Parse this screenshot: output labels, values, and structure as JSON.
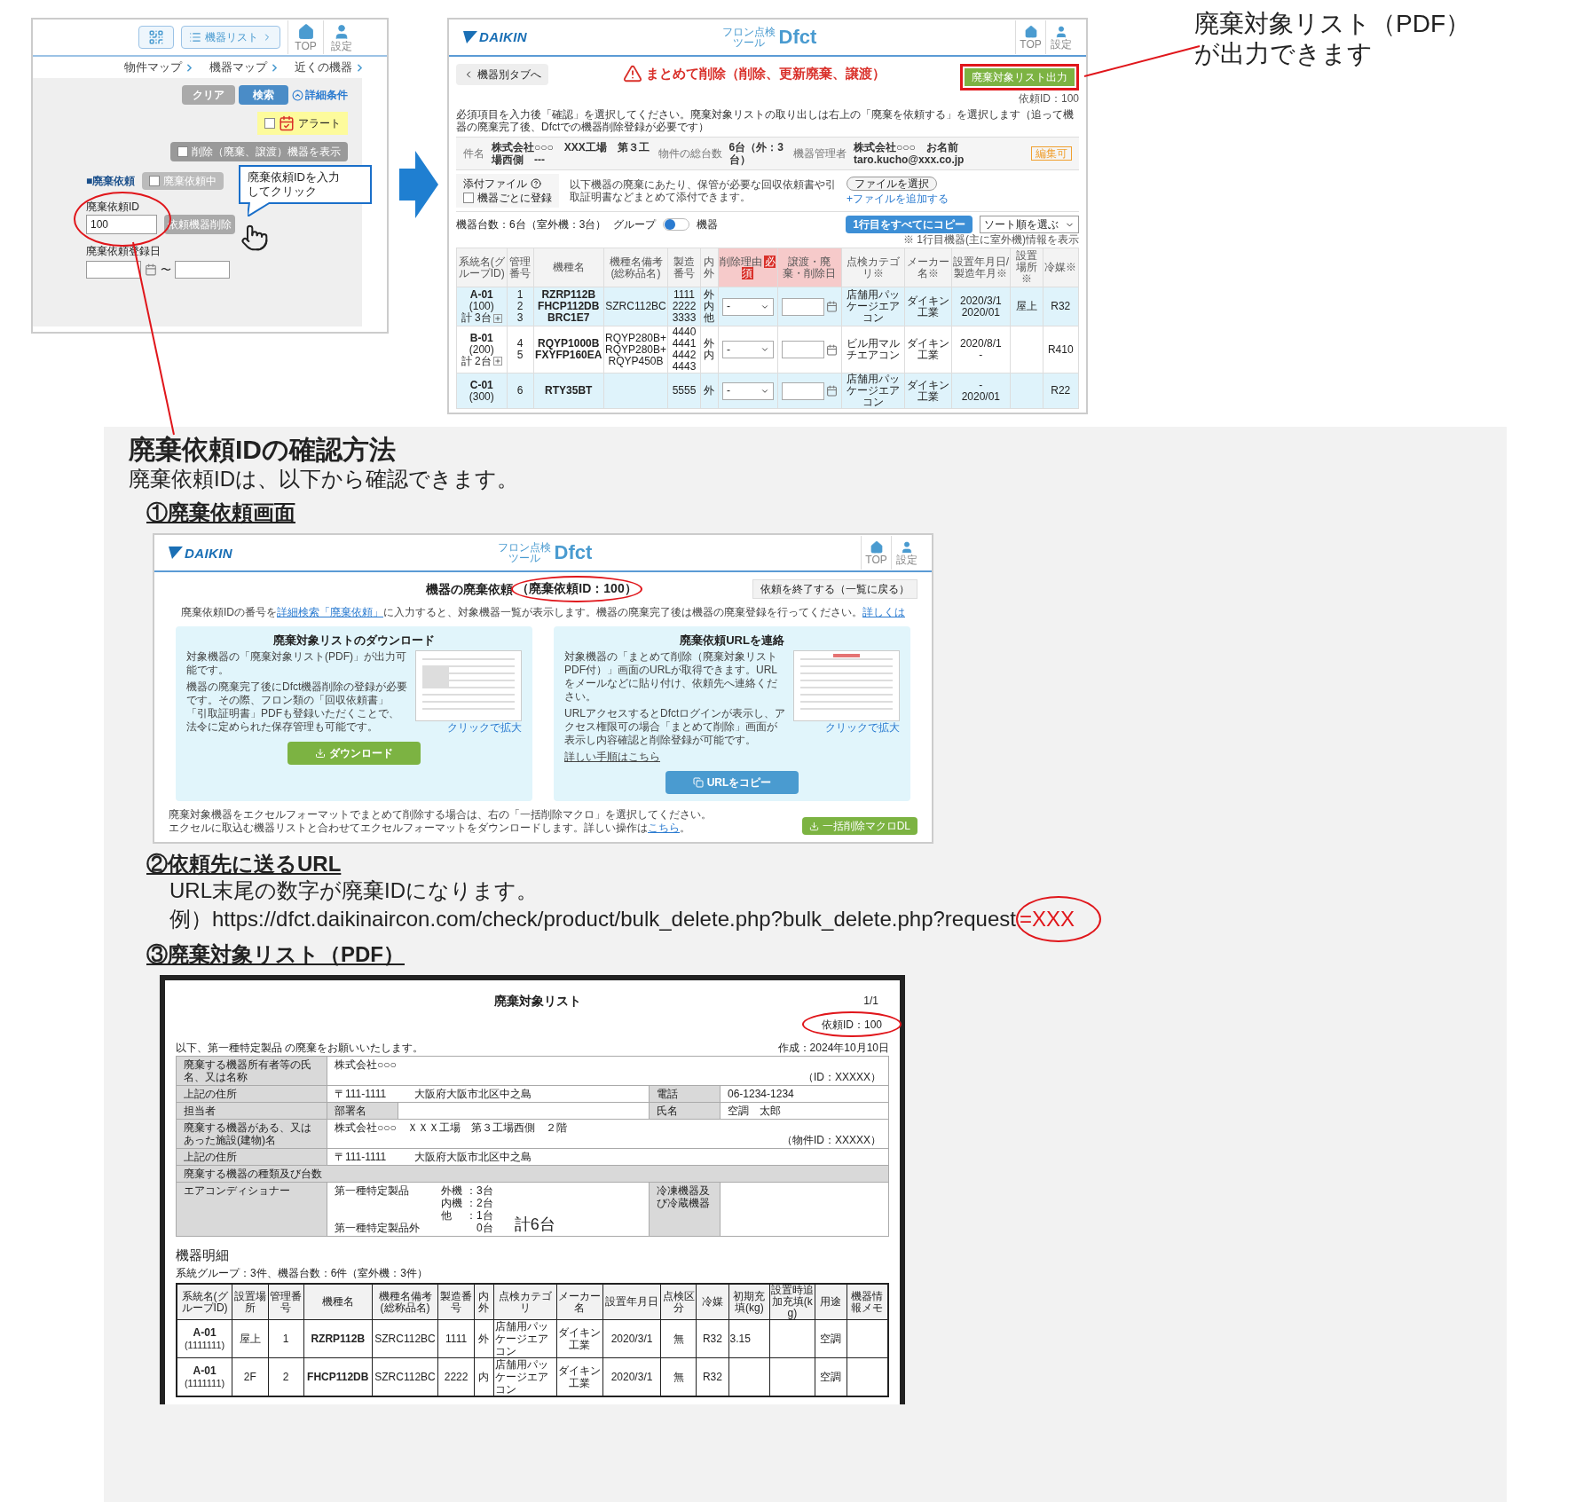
{
  "search_screen": {
    "list_button": "機器リスト",
    "header_icons": [
      {
        "kind": "home",
        "label": "TOP"
      },
      {
        "kind": "user",
        "label": "設定"
      }
    ],
    "nav_links": [
      "物件マップ",
      "機器マップ",
      "近くの機器"
    ],
    "clear_button": "クリア",
    "search_button": "検索",
    "detail_link": "詳細条件",
    "alert": {
      "label": "アラート",
      "checked": false
    },
    "show_deleted": {
      "label": "削除（廃棄、譲渡）機器を表示",
      "checked": false
    },
    "section_label": "■廃棄依頼",
    "pending": {
      "label": "廃棄依頼中",
      "checked": false
    },
    "request_id": {
      "label": "廃棄依頼ID",
      "value": "100"
    },
    "delete_button": "依頼機器削除",
    "date": {
      "label": "廃棄依頼登録日",
      "separator": "〜"
    },
    "callout": [
      "廃棄依頼IDを入力",
      "してクリック"
    ]
  },
  "bulk_delete_screen": {
    "header": {
      "logo": "DAIKIN",
      "app_subtitle": [
        "フロン点検",
        "ツール"
      ],
      "app_name": "Dfct",
      "icons": [
        {
          "kind": "home",
          "label": "TOP"
        },
        {
          "kind": "user",
          "label": "設定"
        }
      ]
    },
    "back_button": "機器別タブへ",
    "title": "まとめて削除（削除、更新廃棄、譲渡）",
    "export_button": "廃棄対象リスト出力",
    "request_id": "依頼ID：100",
    "instruction": "必須項目を入力後「確認」を選択してください。廃棄対象リストの取り出しは右上の「廃棄を依頼する」を選択します（追って機器の廃棄完了後、Dfctでの機器削除登録が必要です）",
    "info": [
      {
        "label": "件名",
        "value": "株式会社○○○　XXX工場　第３工場西側　---"
      },
      {
        "label": "物件の総台数",
        "value": "6台（外：3台）"
      },
      {
        "label": "機器管理者",
        "value": "株式会社○○○　お名前　taro.kucho@xxx.co.jp"
      }
    ],
    "edit_badge": "編集可",
    "attachment": {
      "label": "添付ファイル",
      "per_device": {
        "label": "機器ごとに登録",
        "checked": false
      },
      "note": "以下機器の廃棄にあたり、保管が必要な回収依頼書や引取証明書などまとめて添付できます。",
      "file_button": "ファイルを選択",
      "add_link": "+ファイルを追加する"
    },
    "count": "機器台数：6台（室外機：3台）",
    "view_toggle": {
      "left": "グループ",
      "right": "機器",
      "on": false
    },
    "copy_button": "1行目をすべてにコピー",
    "sort_select": "ソート順を選ぶ",
    "sort_note": "※ 1行目機器(主に室外機)情報を表示",
    "columns": [
      {
        "label": "系統名(グループID)",
        "required": false
      },
      {
        "label": "管理番号",
        "required": false
      },
      {
        "label": "機種名",
        "required": false
      },
      {
        "label": "機種名備考(総称品名)",
        "required": false
      },
      {
        "label": "製造番号",
        "required": false
      },
      {
        "label": "内外",
        "required": false
      },
      {
        "label": "削除理由",
        "required": true,
        "badge": "必須"
      },
      {
        "label": "譲渡・廃棄・削除日",
        "required": true
      },
      {
        "label": "点検カテゴリ※",
        "required": false
      },
      {
        "label": "メーカー名※",
        "required": false
      },
      {
        "label": "設置年月日/製造年月※",
        "required": false
      },
      {
        "label": "設置場所※",
        "required": false
      },
      {
        "label": "冷媒※",
        "required": false
      }
    ],
    "rows": [
      {
        "group": "A-01",
        "group_id": "(100)",
        "total": "計 3台",
        "numbers": [
          "1",
          "2",
          "3"
        ],
        "models": [
          "RZRP112B",
          "FHCP112DB",
          "BRC1E7"
        ],
        "model_notes": [
          "SZRC112BC"
        ],
        "serials": [
          "1111",
          "2222",
          "3333"
        ],
        "inout": [
          "外",
          "内",
          "他"
        ],
        "reason": "-",
        "category": "店舗用パッケージエアコン",
        "maker": "ダイキン工業",
        "dates": [
          "2020/3/1",
          "2020/01"
        ],
        "place": "屋上",
        "refrigerant": "R32"
      },
      {
        "group": "B-01",
        "group_id": "(200)",
        "total": "計 2台",
        "numbers": [
          "4",
          "5"
        ],
        "models": [
          "RQYP1000B",
          "FXYFP160EA"
        ],
        "model_notes": [
          "RQYP280B+",
          "RQYP280B+",
          "RQYP450B"
        ],
        "serials": [
          "4440",
          "4441",
          "4442",
          "4443"
        ],
        "inout": [
          "外",
          "内"
        ],
        "reason": "-",
        "category": "ビル用マルチエアコン",
        "maker": "ダイキン工業",
        "dates": [
          "2020/8/1",
          "-"
        ],
        "refrigerant": "R410"
      },
      {
        "group": "C-01",
        "group_id": "(300)",
        "numbers": [
          "6"
        ],
        "models": [
          "RTY35BT"
        ],
        "serials": [
          "5555"
        ],
        "inout": [
          "外"
        ],
        "reason": "-",
        "category": "店舗用パッケージエアコン",
        "maker": "ダイキン工業",
        "dates": [
          "-",
          "2020/01"
        ],
        "refrigerant": "R22"
      }
    ]
  },
  "annotation": [
    "廃棄対象リスト（PDF）",
    "が出力できます"
  ],
  "guide": {
    "heading": "廃棄依頼IDの確認方法",
    "subtitle": "廃棄依頼IDは、以下から確認できます。",
    "section_1": "①廃棄依頼画面",
    "request_screen": {
      "header": {
        "logo": "DAIKIN",
        "app_subtitle": [
          "フロン点検",
          "ツール"
        ],
        "app_name": "Dfct",
        "icons": [
          {
            "kind": "home",
            "label": "TOP"
          },
          {
            "kind": "user",
            "label": "設定"
          }
        ]
      },
      "title": "機器の廃棄依頼",
      "id_label": "（廃棄依頼ID：100）",
      "end_button": "依頼を終了する（一覧に戻る）",
      "notice": {
        "before": "廃棄依頼IDの番号を",
        "link": "詳細検索「廃棄依頼」",
        "after": "に入力すると、対象機器一覧が表示します。機器の廃棄完了後は機器の廃棄登録を行ってください。",
        "link_2": "詳しくは"
      },
      "cards": [
        {
          "kind": "download",
          "title": "廃棄対象リストのダウンロード",
          "paragraphs": [
            "対象機器の「廃棄対象リスト(PDF)」が出力可能です。",
            "機器の廃棄完了後にDfct機器削除の登録が必要です。その際、フロン類の「回収依頼書」「引取証明書」PDFも登録いただくことで、法令に定められた保存管理も可能です。"
          ],
          "thumb_label": "クリックで拡大",
          "button": "ダウンロード",
          "color": "#7cb342"
        },
        {
          "kind": "copy",
          "title": "廃棄依頼URLを連絡",
          "paragraphs": [
            "対象機器の「まとめて削除（廃棄対象リストPDF付）」画面のURLが取得できます。URLをメールなどに貼り付け、依頼先へ連絡ください。",
            "URLアクセスするとDfctログインが表示し、アクセス権限可の場合「まとめて削除」画面が表示し内容確認と削除登録が可能です。"
          ],
          "link": "詳しい手順はこちら",
          "thumb_label": "クリックで拡大",
          "button": "URLをコピー",
          "color": "#4a9bd0"
        }
      ],
      "bottom_text": [
        "廃棄対象機器をエクセルフォーマットでまとめて削除する場合は、右の「一括削除マクロ」を選択してください。",
        "エクセルに取込む機器リストと合わせてエクセルフォーマットをダウンロードします。詳しい操作は"
      ],
      "bottom_link": "こちら",
      "bottom_end": "。",
      "macro_button": "一括削除マクロDL"
    },
    "section_2": "②依頼先に送るURL",
    "url_note": "URL末尾の数字が廃棄IDになります。",
    "url_prefix": "例）https://dfct.daikinaircon.com/check/product/bulk_delete.php?bulk_delete.php?request",
    "url_suffix": "=XXX",
    "section_3": "③廃棄対象リスト（PDF）",
    "pdf": {
      "title": "廃棄対象リスト",
      "page": "1/1",
      "request_id": "依頼ID：100",
      "intro": "以下、第一種特定製品 の廃棄をお願いいたします。",
      "created": "作成：2024年10月10日",
      "owner": {
        "label": "廃棄する機器所有者等の氏名、又は名称",
        "value": "株式会社○○○",
        "id": "（ID：XXXXX）"
      },
      "address": {
        "label": "上記の住所",
        "postal": "〒111-1111",
        "value": "大阪府大阪市北区中之島",
        "phone_label": "電話",
        "phone": "06-1234-1234"
      },
      "contact": {
        "label": "担当者",
        "dept_label": "部署名",
        "name_label": "氏名",
        "name": "空調　太郎"
      },
      "facility": {
        "label": "廃棄する機器がある、又はあった施設(建物)名",
        "value": "株式会社○○○　ＸＸＸ工場　第３工場西側　２階",
        "id": "（物件ID：XXXXX）"
      },
      "facility_address": {
        "label": "上記の住所",
        "postal": "〒111-1111",
        "value": "大阪府大阪市北区中之島"
      },
      "kinds_header": "廃棄する機器の種類及び台数",
      "aircon": {
        "label": "エアコンディショナー",
        "specified": "第一種特定製品",
        "counts": [
          {
            "label": "外機",
            "value": "：3台"
          },
          {
            "label": "内機",
            "value": "：2台"
          },
          {
            "label": "他",
            "value": "：1台"
          }
        ],
        "not_specified": "第一種特定製品外",
        "not_count": "0台",
        "total": "計6台",
        "fridge_label": "冷凍機器及び冷蔵機器"
      },
      "detail_title": "機器明細",
      "detail_summary": "系統グループ：3件、機器台数：6件（室外機：3件）",
      "detail_columns": [
        "系統名(グループID)",
        "設置場所",
        "管理番号",
        "機種名",
        "機種名備考(総称品名)",
        "製造番号",
        "内外",
        "点検カテゴリ",
        "メーカー名",
        "設置年月日",
        "点検区分",
        "冷媒",
        "初期充填(kg)",
        "設置時追加充填(kg)",
        "用途",
        "機器情報メモ"
      ],
      "detail_rows": [
        {
          "group": "A-01",
          "group_id": "(1111111)",
          "place": "屋上",
          "number": "1",
          "model": "RZRP112B",
          "model_note": "SZRC112BC",
          "serial": "1111",
          "inout": "外",
          "category": "店舗用パッケージエアコン",
          "maker": "ダイキン工業",
          "date": "2020/3/1",
          "inspection": "無",
          "refrigerant": "R32",
          "initial_charge": "3.15",
          "use": "空調"
        },
        {
          "group": "A-01",
          "group_id": "(1111111)",
          "place": "2F",
          "number": "2",
          "model": "FHCP112DB",
          "model_note": "SZRC112BC",
          "serial": "2222",
          "inout": "内",
          "category": "店舗用パッケージエアコン",
          "maker": "ダイキン工業",
          "date": "2020/3/1",
          "inspection": "無",
          "refrigerant": "R32",
          "use": "空調"
        }
      ]
    }
  }
}
